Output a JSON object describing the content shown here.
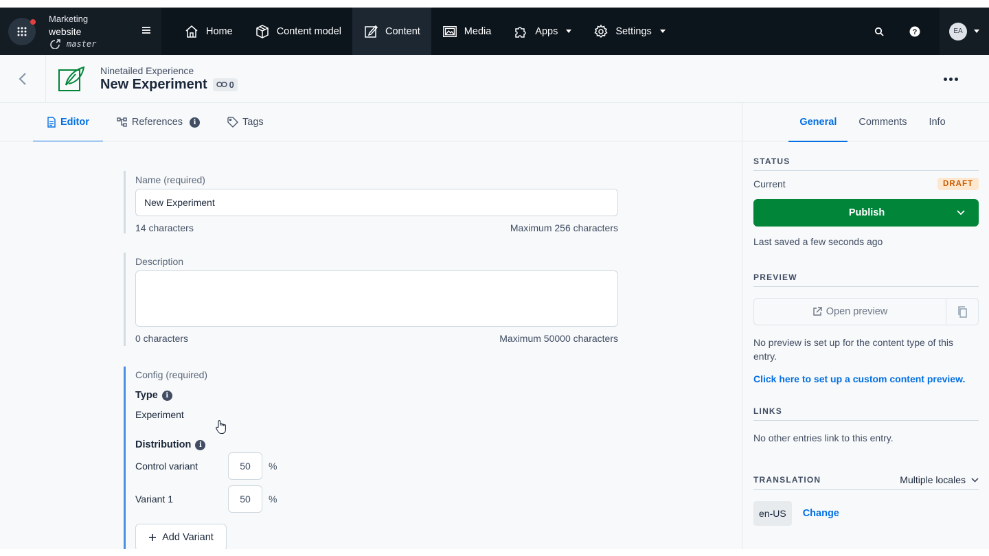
{
  "topnav": {
    "space": {
      "org": "Marketing",
      "name": "website",
      "environment": "master"
    },
    "items": [
      {
        "label": "Home",
        "icon": "home-icon"
      },
      {
        "label": "Content model",
        "icon": "cube-icon"
      },
      {
        "label": "Content",
        "icon": "edit-icon",
        "active": true
      },
      {
        "label": "Media",
        "icon": "image-icon"
      },
      {
        "label": "Apps",
        "icon": "puzzle-icon",
        "dropdown": true
      },
      {
        "label": "Settings",
        "icon": "gear-icon",
        "dropdown": true
      }
    ],
    "account_initials": "EA"
  },
  "entry": {
    "content_type": "Ninetailed Experience",
    "title": "New Experiment",
    "references_count": "0"
  },
  "editor_tabs": [
    {
      "label": "Editor",
      "active": true
    },
    {
      "label": "References"
    },
    {
      "label": "Tags"
    }
  ],
  "fields": {
    "name": {
      "label": "Name (required)",
      "value": "New Experiment",
      "count": "14 characters",
      "max": "Maximum 256 characters"
    },
    "description": {
      "label": "Description",
      "value": "",
      "count": "0 characters",
      "max": "Maximum 50000 characters"
    },
    "config": {
      "label": "Config (required)",
      "type_label": "Type",
      "type_value": "Experiment",
      "distribution_label": "Distribution",
      "variants": [
        {
          "name": "Control variant",
          "value": "50",
          "unit": "%"
        },
        {
          "name": "Variant 1",
          "value": "50",
          "unit": "%"
        }
      ],
      "add_variant_label": "Add Variant"
    }
  },
  "sidebar": {
    "tabs": [
      {
        "label": "General",
        "active": true
      },
      {
        "label": "Comments"
      },
      {
        "label": "Info"
      }
    ],
    "status": {
      "heading": "STATUS",
      "current_label": "Current",
      "badge": "DRAFT",
      "publish_label": "Publish",
      "last_saved": "Last saved a few seconds ago"
    },
    "preview": {
      "heading": "PREVIEW",
      "open_label": "Open preview",
      "note": "No preview is set up for the content type of this entry.",
      "link": "Click here to set up a custom content preview."
    },
    "links": {
      "heading": "LINKS",
      "text": "No other entries link to this entry."
    },
    "translation": {
      "heading": "TRANSLATION",
      "mode": "Multiple locales",
      "locale": "en-US",
      "change_label": "Change"
    }
  },
  "colors": {
    "nav_bg": "#0c141c",
    "accent": "#036fe3",
    "publish": "#008539",
    "draft_bg": "#fde8cf",
    "draft_text": "#c85a00"
  }
}
